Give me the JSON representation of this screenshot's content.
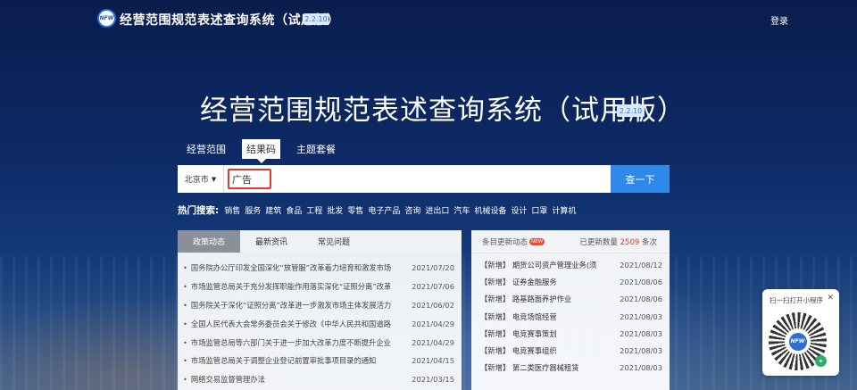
{
  "header": {
    "logo_text": "NFW",
    "site_title": "经营范围规范表述查询系统（试用版）",
    "version": "2.2.10",
    "login_label": "登录"
  },
  "hero": {
    "title": "经营范围规范表述查询系统（试用版）",
    "version": "2.2.10"
  },
  "tabs": [
    {
      "label": "经营范围",
      "active": false
    },
    {
      "label": "结果码",
      "active": true
    },
    {
      "label": "主题套餐",
      "active": false
    }
  ],
  "search": {
    "city": "北京市",
    "query": "广告",
    "button_label": "查一下"
  },
  "hot": {
    "label": "热门搜索:",
    "items": [
      "销售",
      "服务",
      "建筑",
      "食品",
      "工程",
      "批发",
      "零售",
      "电子产品",
      "咨询",
      "进出口",
      "汽车",
      "机械设备",
      "设计",
      "口罩",
      "计算机"
    ]
  },
  "news_panel": {
    "tabs": [
      {
        "label": "政策动态",
        "active": true
      },
      {
        "label": "最新资讯",
        "active": false
      },
      {
        "label": "常见问题",
        "active": false
      }
    ],
    "rows": [
      {
        "title": "国务院办公厅印发全国深化“放管服”改革着力培育和激发市场",
        "date": "2021/07/20"
      },
      {
        "title": "市场监管总局关于充分发挥职能作用落实深化“证照分离”改革",
        "date": "2021/07/06"
      },
      {
        "title": "国务院关于深化“证照分离”改革进一步激发市场主体发展活力",
        "date": "2021/06/02"
      },
      {
        "title": "全国人民代表大会常务委员会关于修改《中华人民共和国道路",
        "date": "2021/04/29"
      },
      {
        "title": "市场监管总局等六部门关于进一步加大改革力度不断提升企业",
        "date": "2021/04/29"
      },
      {
        "title": "市场监管总局关于调整企业登记前置审批事项目录的通知",
        "date": "2021/04/15"
      },
      {
        "title": "网络交易监督管理办法",
        "date": "2021/03/15"
      }
    ]
  },
  "update_panel": {
    "title": "条目更新动态",
    "new_badge": "NEW",
    "count_label": "已更新数量",
    "count": "2509",
    "count_unit": "条次",
    "rows": [
      {
        "tag": "【新增】",
        "title": "期货公司资产管理业务(须",
        "date": "2021/08/12"
      },
      {
        "tag": "【新增】",
        "title": "证券金融服务",
        "date": "2021/08/06"
      },
      {
        "tag": "【新增】",
        "title": "路基路面养护作业",
        "date": "2021/08/06"
      },
      {
        "tag": "【新增】",
        "title": "电竞场馆经营",
        "date": "2021/08/03"
      },
      {
        "tag": "【新增】",
        "title": "电竞赛事策划",
        "date": "2021/08/03"
      },
      {
        "tag": "【新增】",
        "title": "电竞赛事组织",
        "date": "2021/08/03"
      },
      {
        "tag": "【新增】",
        "title": "第二类医疗器械租赁",
        "date": "2021/08/03"
      }
    ]
  },
  "mini_program": {
    "label": "扫一扫打开小程序",
    "close": "✕",
    "logo_text": "NFW"
  }
}
